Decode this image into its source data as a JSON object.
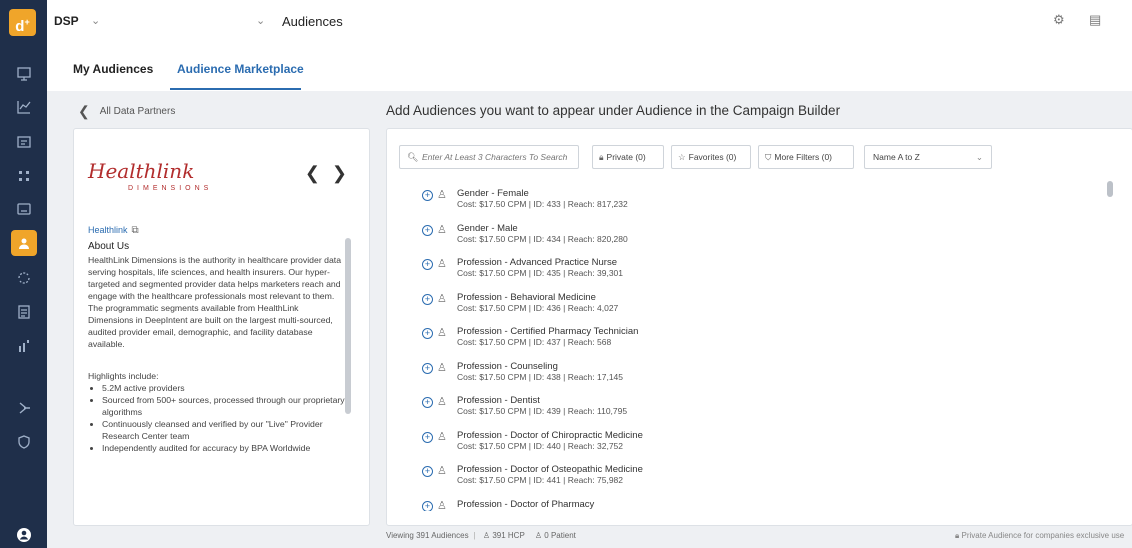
{
  "app": {
    "logo_text": "d",
    "logo_sup": "+",
    "product": "DSP",
    "product_caret": "⌄",
    "page_caret": "⌄",
    "page_title": "Audiences"
  },
  "colors": {
    "rail_bg": "#1f2f4a",
    "accent": "#f0a52a",
    "link": "#2b6cb0",
    "brand_red": "#b22d2d"
  },
  "rail": {
    "icons": [
      "campaigns-icon",
      "analytics-icon",
      "reports-icon",
      "creatives-icon",
      "inventory-icon",
      "audiences-icon",
      "sync-icon",
      "documents-icon",
      "insights-icon",
      "support-icon",
      "admin-icon",
      "account-icon"
    ]
  },
  "tabs": [
    {
      "label": "My Audiences"
    },
    {
      "label": "Audience Marketplace"
    }
  ],
  "back_link": "All Data Partners",
  "partner": {
    "logo_script": "Healthlink",
    "logo_sub": "DIMENSIONS",
    "link_label": "Healthlink",
    "about_title": "About Us",
    "about_p1": "HealthLink Dimensions is the authority in healthcare provider data serving hospitals, life sciences, and health insurers. Our hyper-targeted and segmented provider data helps marketers reach and engage with the healthcare professionals most relevant to them.",
    "about_p2": "The programmatic segments available from HealthLink Dimensions in DeepIntent are built on the largest multi-sourced, audited provider email, demographic, and facility database available.",
    "highlights_title": "Highlights include:",
    "highlights": [
      "5.2M active providers",
      "Sourced from 500+ sources, processed through our proprietary algorithms",
      "Continuously cleansed and verified by our \"Live\" Provider Research Center team",
      "Independently audited for accuracy by BPA Worldwide"
    ]
  },
  "right": {
    "title": "Add Audiences you want to appear under Audience in the Campaign Builder",
    "search_placeholder": "Enter At Least 3 Characters To Search",
    "filters": {
      "private": "Private (0)",
      "favorites": "Favorites (0)",
      "more": "More Filters (0)",
      "sort": "Name A to Z"
    },
    "rows": [
      {
        "name": "Gender - Female",
        "meta": "Cost: $17.50 CPM | ID: 433 | Reach: 817,232"
      },
      {
        "name": "Gender - Male",
        "meta": "Cost: $17.50 CPM | ID: 434 | Reach: 820,280"
      },
      {
        "name": "Profession - Advanced Practice Nurse",
        "meta": "Cost: $17.50 CPM | ID: 435 | Reach: 39,301"
      },
      {
        "name": "Profession - Behavioral Medicine",
        "meta": "Cost: $17.50 CPM | ID: 436 | Reach: 4,027"
      },
      {
        "name": "Profession - Certified Pharmacy Technician",
        "meta": "Cost: $17.50 CPM | ID: 437 | Reach: 568"
      },
      {
        "name": "Profession - Counseling",
        "meta": "Cost: $17.50 CPM | ID: 438 | Reach: 17,145"
      },
      {
        "name": "Profession - Dentist",
        "meta": "Cost: $17.50 CPM | ID: 439 | Reach: 110,795"
      },
      {
        "name": "Profession - Doctor of Chiropractic Medicine",
        "meta": "Cost: $17.50 CPM | ID: 440 | Reach: 32,752"
      },
      {
        "name": "Profession - Doctor of Osteopathic Medicine",
        "meta": "Cost: $17.50 CPM | ID: 441 | Reach: 75,982"
      },
      {
        "name": "Profession - Doctor of Pharmacy",
        "meta": ""
      }
    ]
  },
  "footer": {
    "viewing": "Viewing 391 Audiences",
    "hcp": "391 HCP",
    "patient": "0 Patient",
    "private_note": "Private Audience for companies exclusive use"
  }
}
